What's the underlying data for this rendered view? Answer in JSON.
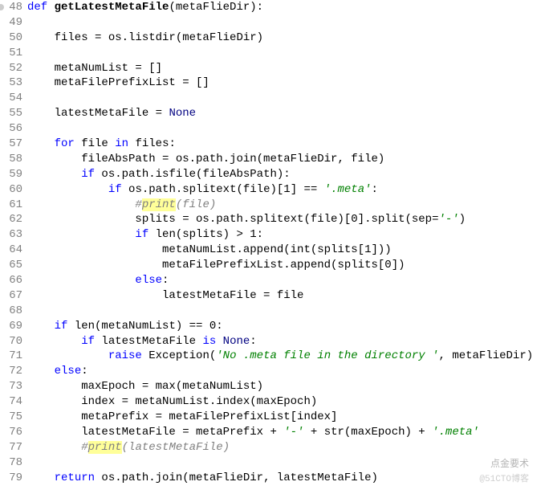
{
  "lines": [
    {
      "n": 48,
      "bp": true,
      "tokens": [
        [
          "kw",
          "def "
        ],
        [
          "fn",
          "getLatestMetaFile"
        ],
        [
          "",
          "(metaFlieDir):"
        ]
      ]
    },
    {
      "n": 49,
      "tokens": []
    },
    {
      "n": 50,
      "tokens": [
        [
          "",
          "    files = os.listdir(metaFlieDir)"
        ]
      ]
    },
    {
      "n": 51,
      "tokens": []
    },
    {
      "n": 52,
      "tokens": [
        [
          "",
          "    metaNumList = []"
        ]
      ]
    },
    {
      "n": 53,
      "tokens": [
        [
          "",
          "    metaFilePrefixList = []"
        ]
      ]
    },
    {
      "n": 54,
      "tokens": []
    },
    {
      "n": 55,
      "tokens": [
        [
          "",
          "    latestMetaFile = "
        ],
        [
          "const",
          "None"
        ]
      ]
    },
    {
      "n": 56,
      "tokens": []
    },
    {
      "n": 57,
      "tokens": [
        [
          "",
          "    "
        ],
        [
          "kw",
          "for"
        ],
        [
          "",
          " file "
        ],
        [
          "kw",
          "in"
        ],
        [
          "",
          " files:"
        ]
      ]
    },
    {
      "n": 58,
      "tokens": [
        [
          "",
          "        fileAbsPath = os.path.join(metaFlieDir, file)"
        ]
      ]
    },
    {
      "n": 59,
      "tokens": [
        [
          "",
          "        "
        ],
        [
          "kw",
          "if"
        ],
        [
          "",
          " os.path.isfile(fileAbsPath):"
        ]
      ]
    },
    {
      "n": 60,
      "tokens": [
        [
          "",
          "            "
        ],
        [
          "kw",
          "if"
        ],
        [
          "",
          " os.path.splitext(file)["
        ],
        [
          "num",
          "1"
        ],
        [
          "",
          "] == "
        ],
        [
          "str",
          "'.meta'"
        ],
        [
          "",
          ":"
        ]
      ]
    },
    {
      "n": 61,
      "tokens": [
        [
          "",
          "                "
        ],
        [
          "cmt",
          "#"
        ],
        [
          "hlcmt",
          "print"
        ],
        [
          "cmt",
          "(file)"
        ]
      ]
    },
    {
      "n": 62,
      "tokens": [
        [
          "",
          "                splits = os.path.splitext(file)["
        ],
        [
          "num",
          "0"
        ],
        [
          "",
          "].split(sep="
        ],
        [
          "str",
          "'-'"
        ],
        [
          "",
          ")"
        ]
      ]
    },
    {
      "n": 63,
      "tokens": [
        [
          "",
          "                "
        ],
        [
          "kw",
          "if"
        ],
        [
          "",
          " len(splits) > "
        ],
        [
          "num",
          "1"
        ],
        [
          "",
          ":"
        ]
      ]
    },
    {
      "n": 64,
      "tokens": [
        [
          "",
          "                    metaNumList.append(int(splits["
        ],
        [
          "num",
          "1"
        ],
        [
          "",
          "]))"
        ]
      ]
    },
    {
      "n": 65,
      "tokens": [
        [
          "",
          "                    metaFilePrefixList.append(splits["
        ],
        [
          "num",
          "0"
        ],
        [
          "",
          "])"
        ]
      ]
    },
    {
      "n": 66,
      "tokens": [
        [
          "",
          "                "
        ],
        [
          "kw",
          "else"
        ],
        [
          "",
          ":"
        ]
      ]
    },
    {
      "n": 67,
      "tokens": [
        [
          "",
          "                    latestMetaFile = file"
        ]
      ]
    },
    {
      "n": 68,
      "tokens": []
    },
    {
      "n": 69,
      "tokens": [
        [
          "",
          "    "
        ],
        [
          "kw",
          "if"
        ],
        [
          "",
          " len(metaNumList) == "
        ],
        [
          "num",
          "0"
        ],
        [
          "",
          ":"
        ]
      ]
    },
    {
      "n": 70,
      "tokens": [
        [
          "",
          "        "
        ],
        [
          "kw",
          "if"
        ],
        [
          "",
          " latestMetaFile "
        ],
        [
          "kw",
          "is"
        ],
        [
          "",
          " "
        ],
        [
          "const",
          "None"
        ],
        [
          "",
          ":"
        ]
      ]
    },
    {
      "n": 71,
      "tokens": [
        [
          "",
          "            "
        ],
        [
          "kw",
          "raise"
        ],
        [
          "",
          " Exception("
        ],
        [
          "str",
          "'No .meta file in the directory '"
        ],
        [
          "",
          ", metaFlieDir)"
        ]
      ]
    },
    {
      "n": 72,
      "tokens": [
        [
          "",
          "    "
        ],
        [
          "kw",
          "else"
        ],
        [
          "",
          ":"
        ]
      ]
    },
    {
      "n": 73,
      "tokens": [
        [
          "",
          "        maxEpoch = max(metaNumList)"
        ]
      ]
    },
    {
      "n": 74,
      "tokens": [
        [
          "",
          "        index = metaNumList.index(maxEpoch)"
        ]
      ]
    },
    {
      "n": 75,
      "tokens": [
        [
          "",
          "        metaPrefix = metaFilePrefixList[index]"
        ]
      ]
    },
    {
      "n": 76,
      "tokens": [
        [
          "",
          "        latestMetaFile = metaPrefix + "
        ],
        [
          "str",
          "'-'"
        ],
        [
          "",
          " + str(maxEpoch) + "
        ],
        [
          "str",
          "'.meta'"
        ]
      ]
    },
    {
      "n": 77,
      "tokens": [
        [
          "",
          "        "
        ],
        [
          "cmt",
          "#"
        ],
        [
          "hlcmt",
          "print"
        ],
        [
          "cmt",
          "(latestMetaFile)"
        ]
      ]
    },
    {
      "n": 78,
      "tokens": []
    },
    {
      "n": 79,
      "tokens": [
        [
          "",
          "    "
        ],
        [
          "kw",
          "return"
        ],
        [
          "",
          " os.path.join(metaFlieDir, latestMetaFile)"
        ]
      ]
    }
  ],
  "watermark1": "点金要术",
  "watermark2": "@51CTO博客"
}
